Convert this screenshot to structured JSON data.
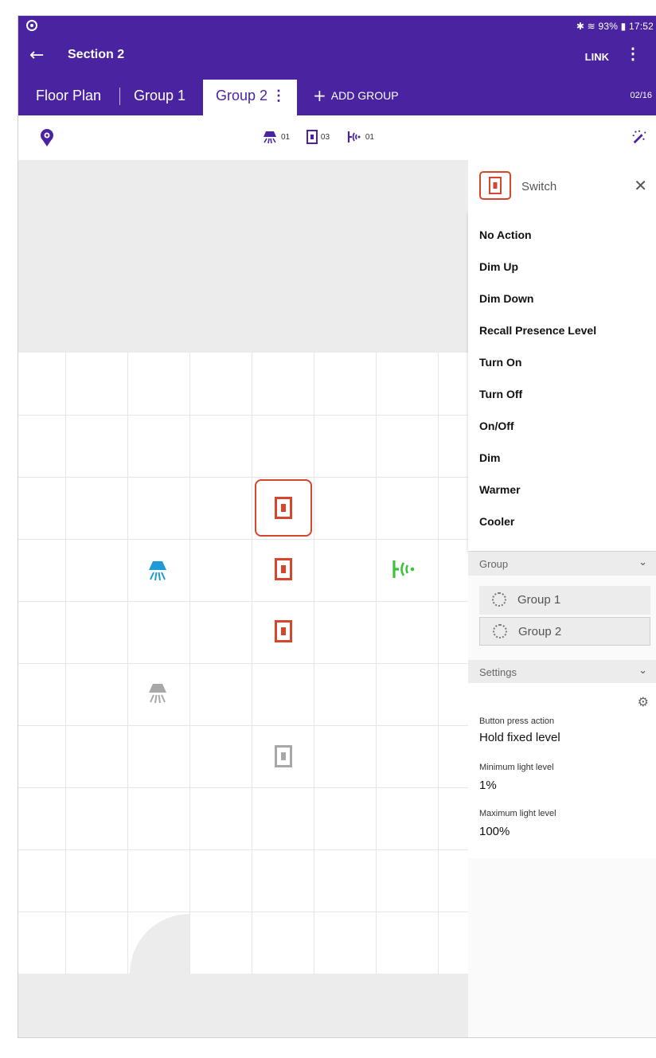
{
  "status_bar": {
    "right": "✱ ≋ 93% ▮ 17:52"
  },
  "app_bar": {
    "back_icon": "arrow-back-icon",
    "title": "Section 2",
    "link_label": "LINK",
    "menu_icon": "more-vert-icon"
  },
  "tabs": [
    {
      "label": "Floor Plan"
    },
    {
      "label": "Group 1"
    },
    {
      "label": "Group 2",
      "active": true
    }
  ],
  "add_group": {
    "label": "ADD GROUP"
  },
  "page_count": "02/16",
  "toolbar": {
    "left_icon": "location-pin-icon",
    "counts": [
      {
        "icon": "light-fixture-icon",
        "value": "01"
      },
      {
        "icon": "switch-icon",
        "value": "03"
      },
      {
        "icon": "sensor-icon",
        "value": "01"
      }
    ],
    "right_icon": "magic-wand-icon"
  },
  "colors": {
    "brand": "#4a24a0",
    "switch": "#d6462c",
    "light_active": "#1e9ad6",
    "sensor": "#3bc43b",
    "inactive": "#a8a8a8"
  },
  "panel": {
    "header": {
      "label": "Switch",
      "close_icon": "close-icon"
    },
    "menu": [
      "No Action",
      "Dim Up",
      "Dim Down",
      "Recall Presence Level",
      "Turn On",
      "Turn Off",
      "On/Off",
      "Dim",
      "Warmer",
      "Cooler"
    ],
    "group_section": {
      "label": "Group",
      "chevron": "⌄"
    },
    "groups": [
      {
        "label": "Group 1"
      },
      {
        "label": "Group 2",
        "selected": true
      }
    ],
    "settings_section": {
      "label": "Settings",
      "chevron": "⌄"
    },
    "settings": [
      {
        "label": "Button press action",
        "value": "Hold fixed level"
      },
      {
        "label": "Minimum light level",
        "value": "1%"
      },
      {
        "label": "Maximum light level",
        "value": "100%"
      }
    ]
  }
}
